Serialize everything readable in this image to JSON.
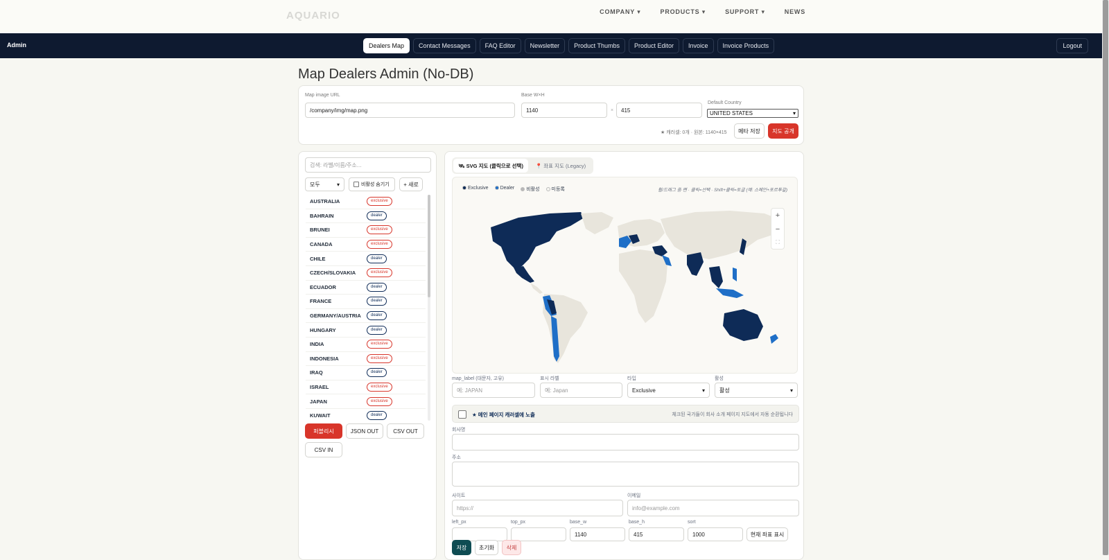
{
  "site": {
    "logo": "AQUARIO",
    "nav": [
      "COMPANY ▾",
      "PRODUCTS ▾",
      "SUPPORT ▾",
      "NEWS"
    ]
  },
  "admin": {
    "label": "Admin",
    "tabs": [
      "Dealers Map",
      "Contact Messages",
      "FAQ Editor",
      "Newsletter",
      "Product Thumbs",
      "Product Editor",
      "Invoice",
      "Invoice Products"
    ],
    "logout": "Logout"
  },
  "page_title": "Map Dealers Admin (No-DB)",
  "meta": {
    "map_url_label": "Map image URL",
    "map_url_value": "/company/img/map.png",
    "base_label": "Base W×H",
    "base_w": "1140",
    "times": "×",
    "base_h": "415",
    "country_label": "Default Country",
    "country_value": "UNITED STATES",
    "info": "★ 캐러셀: 0개 · 원본: 1140×415",
    "save_meta": "메타 저장",
    "publish_map": "지도 공개"
  },
  "left": {
    "search_placeholder": "검색: 라벨/이름/주소...",
    "filter_value": "모두",
    "hide_inactive": "비활성 숨기기",
    "new_button": "+ 새로",
    "dealers": [
      {
        "name": "AUSTRALIA",
        "type": "exclusive"
      },
      {
        "name": "BAHRAIN",
        "type": "dealer"
      },
      {
        "name": "BRUNEI",
        "type": "exclusive"
      },
      {
        "name": "CANADA",
        "type": "exclusive"
      },
      {
        "name": "CHILE",
        "type": "dealer"
      },
      {
        "name": "CZECH/SLOVAKIA",
        "type": "exclusive"
      },
      {
        "name": "ECUADOR",
        "type": "dealer"
      },
      {
        "name": "FRANCE",
        "type": "dealer"
      },
      {
        "name": "GERMANY/AUSTRIA",
        "type": "dealer"
      },
      {
        "name": "HUNGARY",
        "type": "dealer"
      },
      {
        "name": "INDIA",
        "type": "exclusive"
      },
      {
        "name": "INDONESIA",
        "type": "exclusive"
      },
      {
        "name": "IRAQ",
        "type": "dealer"
      },
      {
        "name": "ISRAEL",
        "type": "exclusive"
      },
      {
        "name": "JAPAN",
        "type": "exclusive"
      },
      {
        "name": "KUWAIT",
        "type": "dealer"
      }
    ],
    "publish": "퍼블리시",
    "json_out": "JSON OUT",
    "csv_out": "CSV OUT",
    "csv_in": "CSV IN"
  },
  "right": {
    "tab_svg": "🛰 SVG 지도 (클릭으로 선택)",
    "tab_legacy": "📍 좌표 지도 (Legacy)",
    "legend": [
      {
        "label": "Exclusive",
        "color": "#0e2b57"
      },
      {
        "label": "Dealer",
        "color": "#1f6fc7"
      },
      {
        "label": "비활성",
        "color": "#b8b8b8"
      },
      {
        "label": "미등록",
        "color": "#f5f5f0"
      }
    ],
    "hint": "휠/드래그 줌·팬 · 클릭=선택 · Shift+클릭=토글 (예: 스페인+포르투갈)",
    "zoom_in": "+",
    "zoom_out": "−",
    "fullscreen": "⛶",
    "colors": {
      "exclusive": "#0e2b57",
      "dealer": "#1f6fc7",
      "land": "#e8e5dc"
    },
    "form": {
      "map_label_lbl": "map_label (대문자, 고유)",
      "map_label_ph": "예: JAPAN",
      "display_lbl": "표시 라벨",
      "display_ph": "예: Japan",
      "type_lbl": "타입",
      "type_value": "Exclusive",
      "active_lbl": "활성",
      "active_value": "활성",
      "carousel_text": "★ 메인 페이지 캐러셀에 노출",
      "carousel_note": "체크된 국가들이 회사 소개 페이지 지도에서 자동 순환됩니다",
      "company_lbl": "회사명",
      "address_lbl": "주소",
      "site_lbl": "사이트",
      "site_ph": "https://",
      "email_lbl": "이메일",
      "email_ph": "info@example.com",
      "left_lbl": "left_px",
      "top_lbl": "top_px",
      "bw_lbl": "base_w",
      "bw_value": "1140",
      "bh_lbl": "base_h",
      "bh_value": "415",
      "sort_lbl": "sort",
      "sort_value": "1000",
      "show_coords": "현재 좌표 표시",
      "save": "저장",
      "reset": "초기화",
      "delete": "삭제"
    }
  }
}
